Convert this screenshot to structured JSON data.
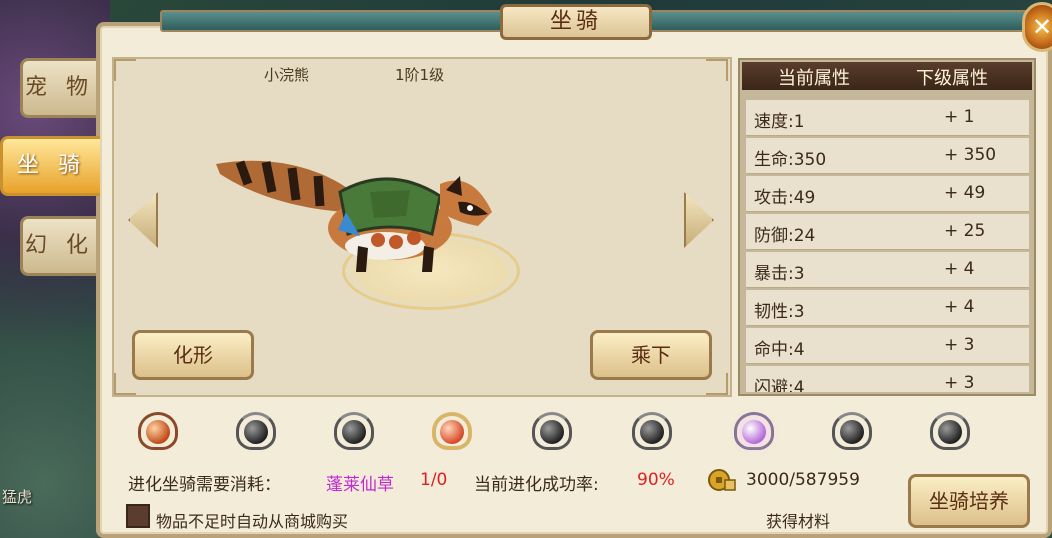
{
  "window": {
    "title": "坐骑",
    "close_symbol": "✕"
  },
  "tabs": [
    {
      "label": "宠 物",
      "active": false
    },
    {
      "label": "坐 骑",
      "active": true
    },
    {
      "label": "幻 化",
      "active": false
    }
  ],
  "background": {
    "player_name": "猛虎"
  },
  "mount": {
    "name": "小浣熊",
    "rank": "1阶1级"
  },
  "buttons": {
    "transform": "化形",
    "dismount": "乘下",
    "train": "坐骑培养",
    "get_material": "获得材料"
  },
  "attributes": {
    "header_current": "当前属性",
    "header_next": "下级属性",
    "rows": [
      {
        "current": "速度:1",
        "next": "+ 1"
      },
      {
        "current": "生命:350",
        "next": "+ 350"
      },
      {
        "current": "攻击:49",
        "next": "+ 49"
      },
      {
        "current": "防御:24",
        "next": "+ 25"
      },
      {
        "current": "暴击:3",
        "next": "+ 4"
      },
      {
        "current": "韧性:3",
        "next": "+ 4"
      },
      {
        "current": "命中:4",
        "next": "+ 3"
      },
      {
        "current": "闪避:4",
        "next": "+ 3"
      }
    ]
  },
  "evolution": {
    "cost_label": "进化坐骑需要消耗：",
    "item_name": "蓬莱仙草",
    "item_count": "1/0",
    "rate_label": "当前进化成功率:",
    "rate_value": "90%",
    "currency": "3000/587959",
    "auto_buy_label": "物品不足时自动从商城购买",
    "auto_buy_checked": false,
    "stars_total": 9,
    "stars_lit": 1
  },
  "colors": {
    "item_name": "#c02ad0",
    "item_count": "#e02020",
    "rate_value": "#e02020"
  }
}
